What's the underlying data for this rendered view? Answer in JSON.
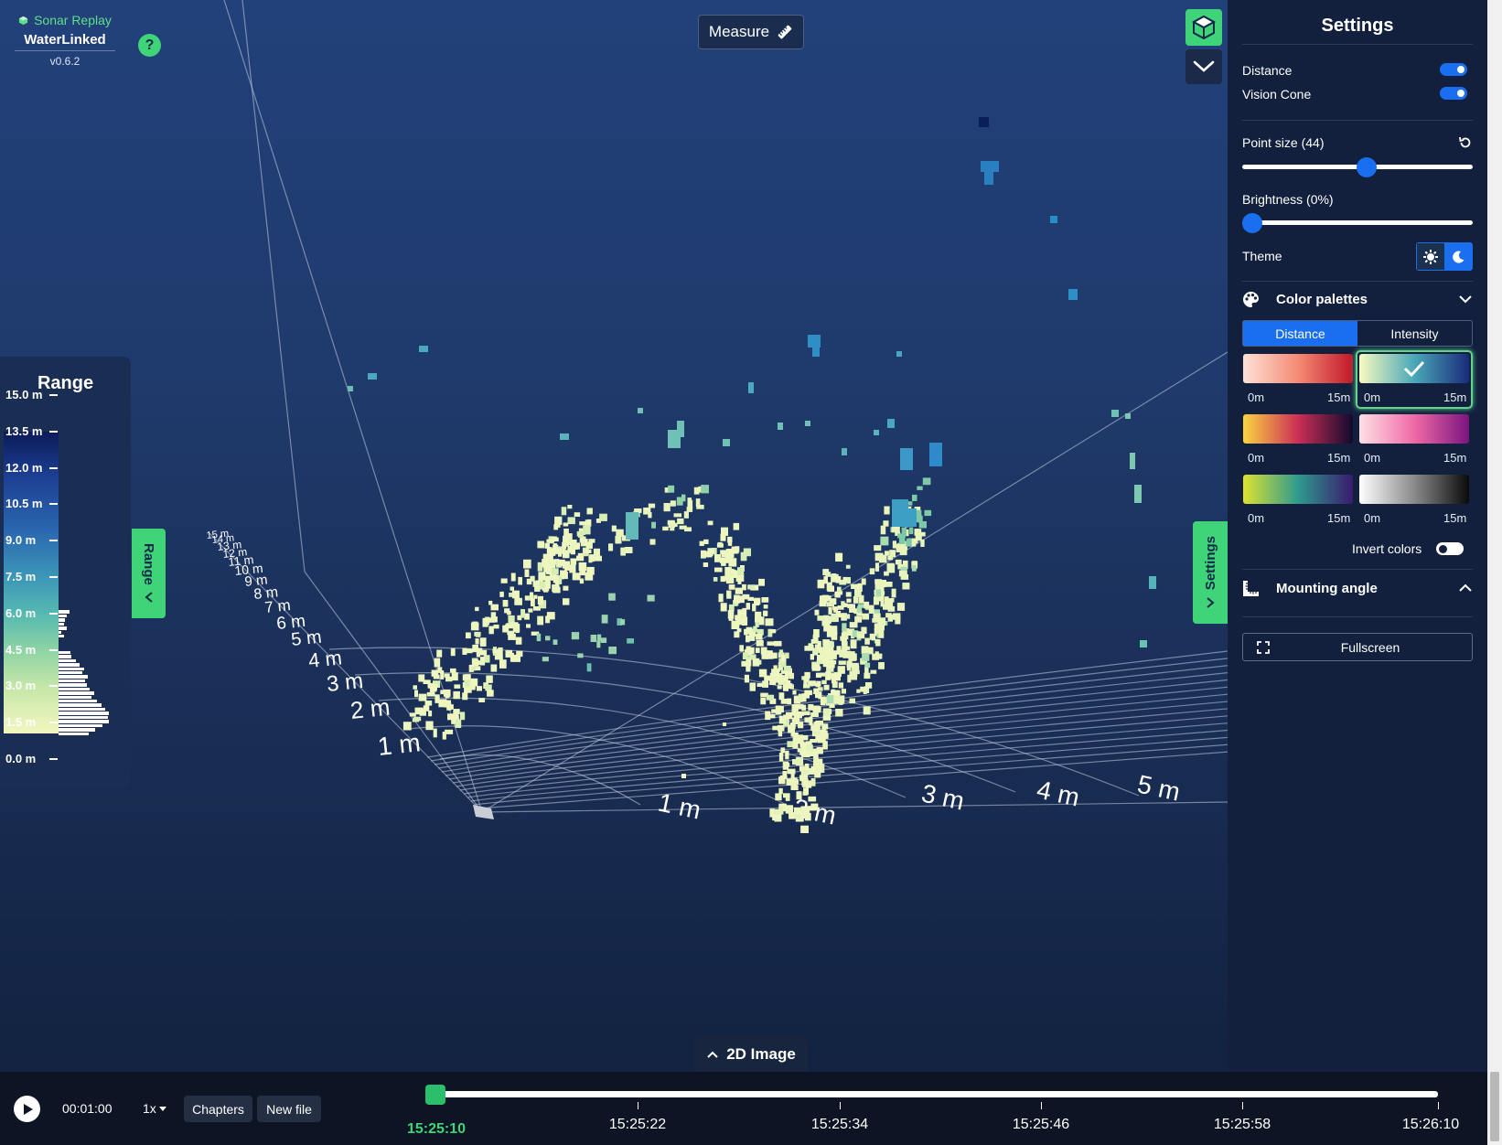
{
  "app": {
    "product": "Sonar Replay",
    "brand": "WaterLinked",
    "version": "v0.6.2",
    "help_label": "?"
  },
  "toolbar": {
    "measure_label": "Measure",
    "view_cube_icon": "cube-icon",
    "view_dropdown_icon": "chevron-down-icon"
  },
  "range_panel": {
    "title": "Range",
    "tab_label": "Range",
    "ticks": [
      "15.0 m",
      "13.5 m",
      "12.0 m",
      "10.5 m",
      "9.0 m",
      "7.5 m",
      "6.0 m",
      "4.5 m",
      "3.0 m",
      "1.5 m",
      "0.0 m"
    ],
    "histogram": [
      0,
      0,
      0,
      0,
      0,
      0,
      0,
      0,
      0,
      0,
      0,
      0,
      0,
      0,
      0,
      0,
      0,
      0,
      0,
      0,
      0,
      0,
      0,
      0,
      0,
      0,
      0,
      0,
      0,
      0,
      0,
      0,
      0,
      0,
      0,
      0,
      0,
      0,
      0,
      0,
      0,
      0,
      0,
      0,
      0.22,
      0.16,
      0.12,
      0.1,
      0.16,
      0.06,
      0.1,
      0.0,
      0.0,
      0.0,
      0.24,
      0.26,
      0.34,
      0.42,
      0.5,
      0.48,
      0.58,
      0.52,
      0.56,
      0.62,
      0.7,
      0.66,
      0.76,
      0.86,
      0.92,
      1.0,
      0.98,
      1.0,
      0.88,
      0.72,
      0.6
    ]
  },
  "scene": {
    "near_range_labels": [
      "1 m",
      "2 m",
      "3 m",
      "4 m",
      "5 m",
      "6 m",
      "7 m",
      "8 m",
      "9 m",
      "10 m",
      "11 m",
      "12 m",
      "13 m",
      "14 m",
      "15 m"
    ],
    "far_range_labels": [
      "1 m",
      "2 m",
      "3 m",
      "4 m",
      "5 m"
    ]
  },
  "image2d_label": "2D Image",
  "settings": {
    "title": "Settings",
    "tab_label": "Settings",
    "distance_label": "Distance",
    "distance_on": true,
    "vision_cone_label": "Vision Cone",
    "vision_cone_on": true,
    "point_size_label": "Point size (44)",
    "point_size_value": 0.54,
    "brightness_label": "Brightness (0%)",
    "brightness_value": 0.0,
    "theme_label": "Theme",
    "theme_selected": "dark",
    "color_palettes_label": "Color palettes",
    "palette_tabs": [
      "Distance",
      "Intensity"
    ],
    "palette_tab_active": 0,
    "palettes": [
      {
        "from": "0m",
        "to": "15m",
        "colors": [
          "#fde2d8",
          "#f58a74",
          "#c0182a"
        ],
        "selected": false
      },
      {
        "from": "0m",
        "to": "15m",
        "colors": [
          "#f7fabf",
          "#4aa8b8",
          "#1b2a7a"
        ],
        "selected": true
      },
      {
        "from": "0m",
        "to": "15m",
        "colors": [
          "#fbd442",
          "#cc2e55",
          "#120a2e"
        ],
        "selected": false
      },
      {
        "from": "0m",
        "to": "15m",
        "colors": [
          "#fde0e6",
          "#f06aa6",
          "#7b1480"
        ],
        "selected": false
      },
      {
        "from": "0m",
        "to": "15m",
        "colors": [
          "#dde330",
          "#2e9a8e",
          "#3a1a6e"
        ],
        "selected": false
      },
      {
        "from": "0m",
        "to": "15m",
        "colors": [
          "#ffffff",
          "#8a8a8a",
          "#0a0a0a"
        ],
        "selected": false
      }
    ],
    "invert_colors_label": "Invert colors",
    "invert_colors_on": false,
    "mounting_angle_label": "Mounting angle",
    "fullscreen_label": "Fullscreen"
  },
  "playback": {
    "elapsed": "00:01:00",
    "speed": "1x",
    "chapters_label": "Chapters",
    "new_file_label": "New file",
    "progress": 0.0,
    "current_time": "15:25:10",
    "time_ticks": [
      "15:25:22",
      "15:25:34",
      "15:25:46",
      "15:25:58",
      "15:26:10"
    ]
  }
}
